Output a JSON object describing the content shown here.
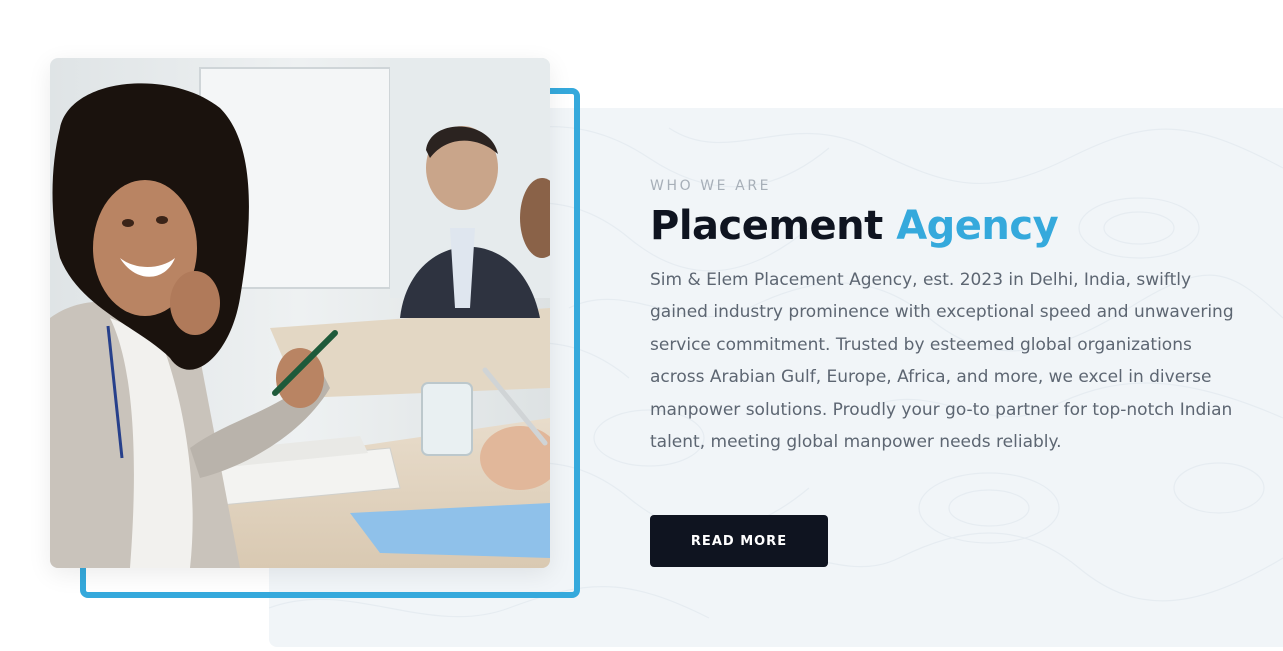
{
  "section": {
    "eyebrow": "WHO WE ARE",
    "title_main": "Placement",
    "title_accent": "Agency",
    "description": "Sim & Elem Placement Agency, est. 2023 in Delhi, India, swiftly gained industry prominence with exceptional speed and unwavering service commitment. Trusted by esteemed global organizations across Arabian Gulf, Europe, Africa, and more, we excel in diverse manpower solutions. Proudly your go-to partner for top-notch Indian talent, meeting global manpower needs reliably.",
    "button_label": "READ MORE"
  },
  "colors": {
    "accent": "#35a9dc",
    "dark": "#0f1420",
    "panel_bg": "#f1f5f8",
    "text_muted": "#5d6672"
  },
  "image": {
    "subject": "business-meeting-photo"
  }
}
